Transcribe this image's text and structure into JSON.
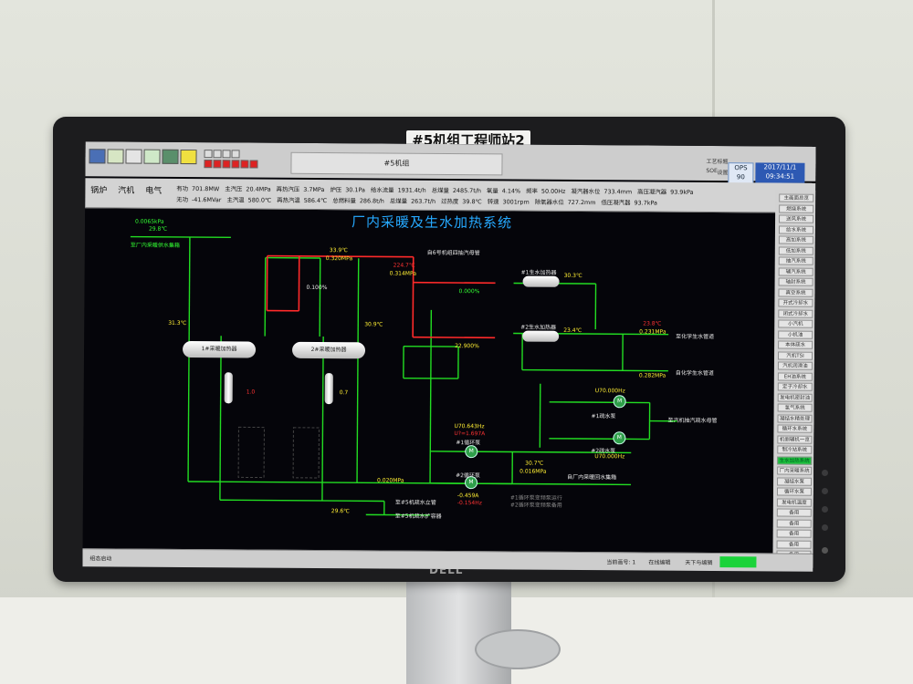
{
  "monitor": {
    "label": "#5机组工程师站2",
    "brand": "DELL"
  },
  "toolbar": {
    "center_title": "#5机组",
    "right_labels": [
      "工艺标题",
      "SOE",
      "设置"
    ],
    "ops": [
      "OPS",
      "90"
    ],
    "date": "2017/11/1",
    "time": "09:34:51"
  },
  "status": {
    "tabs": [
      "锅炉",
      "汽机",
      "电气"
    ],
    "row1": [
      "有功",
      "701.8MW",
      "主汽压",
      "20.4MPa",
      "再热汽压",
      "3.7MPa",
      "炉压",
      "30.1Pa",
      "给水流量",
      "1931.4t/h",
      "总煤量",
      "2485.7t/h",
      "氧量",
      "4.14%",
      "频率",
      "50.00Hz",
      "凝汽器水位",
      "733.4mm",
      "高压凝汽器",
      "93.9kPa"
    ],
    "row2": [
      "无功",
      "-41.6MVar",
      "主汽温",
      "580.0℃",
      "再热汽温",
      "586.4℃",
      "总燃料量",
      "286.8t/h",
      "总煤量",
      "263.7t/h",
      "过热度",
      "39.8℃",
      "转速",
      "3001rpm",
      "除氧器水位",
      "727.2mm",
      "低压凝汽器",
      "93.7kPa"
    ]
  },
  "right_panel": {
    "items": [
      "主画面总览",
      "燃烧系统",
      "送风系统",
      "给水系统",
      "高加系统",
      "低加系统",
      "抽汽系统",
      "辅汽系统",
      "轴封系统",
      "真空系统",
      "开式冷却水",
      "闭式冷却水",
      "小汽机",
      "小机油",
      "本体疏水",
      "汽机TSI",
      "汽机润滑油",
      "EH油系统",
      "定子冷却水",
      "发电机密封油",
      "氢气系统",
      "凝结水精处理",
      "循环水系统",
      "机侧辅机一览",
      "制冷站系统",
      "生水加热系统",
      "厂内采暖系统",
      "凝结水泵",
      "循环水泵",
      "发电机温度",
      "备用",
      "备用",
      "备用",
      "备用",
      "备用"
    ],
    "active_index": 25
  },
  "taskbar": {
    "start": "组态启动",
    "items": [
      "当前画号: 1",
      "在线编辑",
      "天下与编辑"
    ]
  },
  "diagram": {
    "title": "厂内采暖及生水加热系统",
    "labels": {
      "top_left_pressure": "0.0065kPa",
      "top_left_temp": "29.8℃",
      "to_heating_water_tank": "至厂内采暖供水集箱",
      "t_33_9": "33.9℃",
      "p_0_320": "0.320MPa",
      "valve_left_pct": "0.100%",
      "t_31_3": "31.3℃",
      "t_30_9": "30.9℃",
      "hx_left": "1#采暖加热器",
      "hx_right": "2#采暖加热器",
      "level_left": "1.0",
      "level_right": "0.7",
      "t_224_7": "224.7℃",
      "p_0_314": "0.314MPa",
      "steam_source": "自6号机组四抽汽母管",
      "valve_pct_top": "0.000%",
      "valve_pct_bottom": "22.900%",
      "heater1": "#1生水加热器",
      "heater2": "#2生水加热器",
      "t_30_3": "30.3℃",
      "t_23_4": "23.4℃",
      "t_23_8": "23.8℃",
      "p_0_231": "0.231MPa",
      "p_0_282": "0.282MPa",
      "to_raw_water1": "至化学生水管道",
      "from_raw_water": "自化学生水管道",
      "pump_freq1": "U70.000Hz",
      "pump_freq2": "U70.000Hz",
      "pump_freq3": "U70.643Hz",
      "pump_freq4": "U?=1.697A",
      "drain_pump1": "#1疏水泵",
      "drain_pump2": "#2疏水泵",
      "to_steam_header": "至汽机抽汽疏水母管",
      "t_30_7": "30.7℃",
      "p_0_016": "0.016MPa",
      "from_heating_return": "自厂内采暖回水集箱",
      "p_0_020": "0.020MPa",
      "pump_val1": "-0.459A",
      "pump_val2": "-0.154Hz",
      "t_29_6": "29.6℃",
      "to_condenser1": "至#5机疏水立管",
      "to_condenser2": "至#5机疏水扩容器",
      "circ_pump1": "#1循环泵",
      "circ_pump2": "#2循环泵",
      "note1": "#1循环泵变频泵运行",
      "note2": "#2循环泵变频泵备用"
    }
  },
  "colors": {
    "screen_bg": "#05050a",
    "pipe_green": "#22dd22",
    "pipe_red": "#ff2a2a",
    "title_blue": "#26a9ff",
    "active_btn": "#1bc23c",
    "clock_bg": "#2d59b3"
  }
}
